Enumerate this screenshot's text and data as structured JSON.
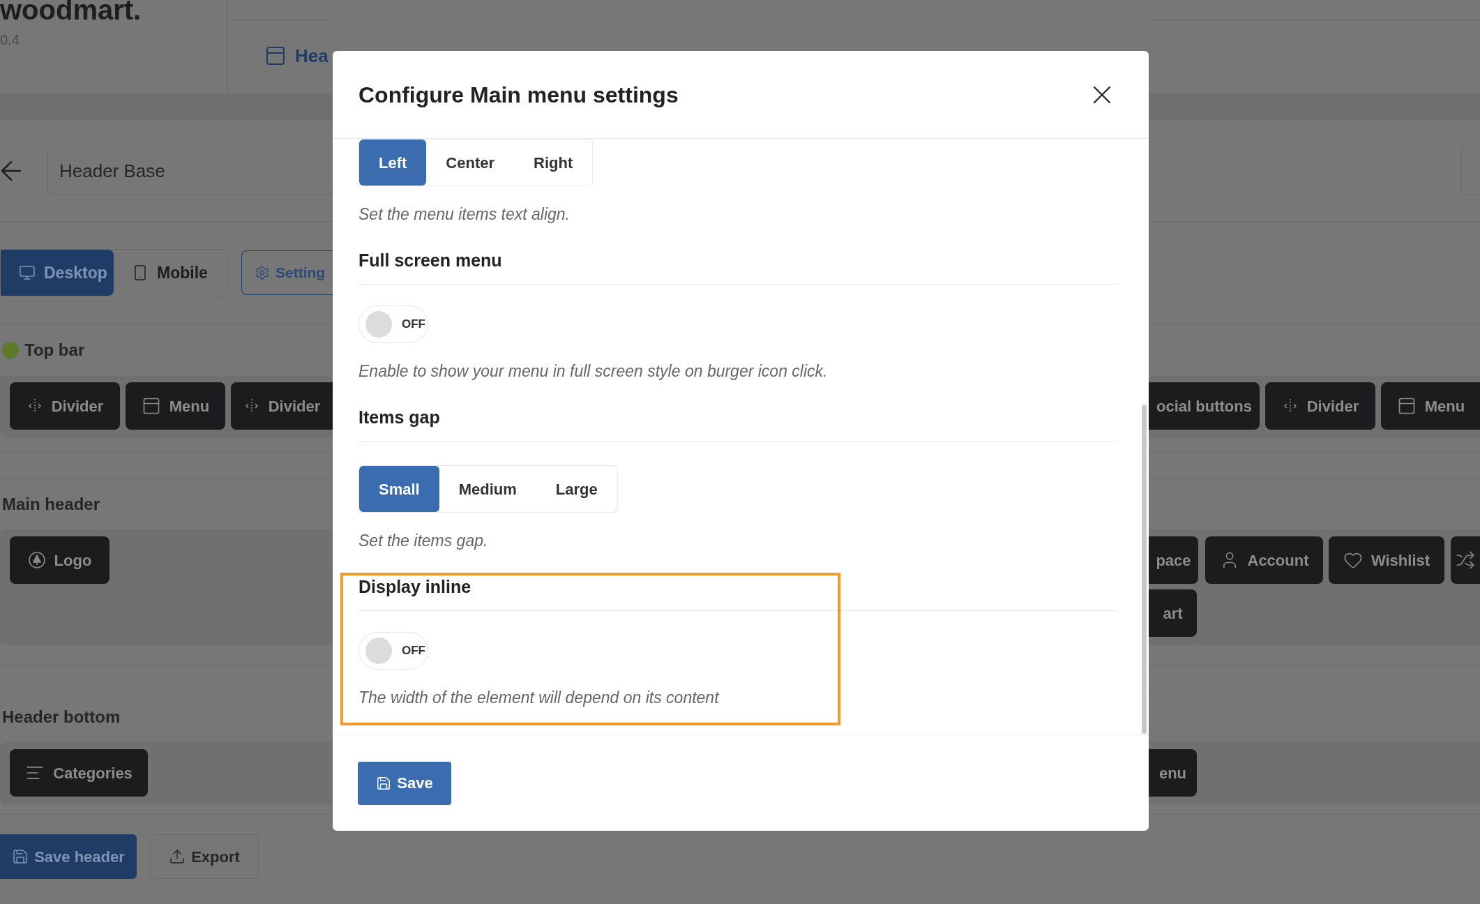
{
  "background": {
    "logo": "woodmart.",
    "version": "0.4",
    "nav_tab": "Hea",
    "back_label": "Header Base",
    "view_tabs": [
      {
        "label": "Desktop",
        "selected": true
      },
      {
        "label": "Mobile",
        "selected": false
      }
    ],
    "settings_button": "Setting",
    "rows": [
      {
        "title": "Top bar",
        "color": "#5d7a2b",
        "left": [
          {
            "kind": "divider",
            "label": "Divider"
          },
          {
            "kind": "menu",
            "label": "Menu"
          },
          {
            "kind": "divider",
            "label": "Divider"
          }
        ],
        "right": [
          [
            {
              "kind": "text",
              "label": "ocial buttons"
            },
            {
              "kind": "divider",
              "label": "Divider"
            },
            {
              "kind": "menu",
              "label": "Menu"
            }
          ]
        ]
      },
      {
        "title": "Main header",
        "left": [
          {
            "kind": "logo",
            "label": "Logo"
          }
        ],
        "right": [
          [
            {
              "kind": "text",
              "label": "pace"
            },
            {
              "kind": "account",
              "label": "Account"
            },
            {
              "kind": "wishlist",
              "label": "Wishlist"
            },
            {
              "kind": "compare"
            }
          ],
          [
            {
              "kind": "text",
              "label": "art"
            }
          ]
        ]
      },
      {
        "title": "Header bottom",
        "left": [
          {
            "kind": "categories",
            "label": "Categories"
          }
        ],
        "right": [
          [
            {
              "kind": "text",
              "label": "enu"
            }
          ]
        ]
      }
    ],
    "save_header": "Save header",
    "export": "Export"
  },
  "dialog": {
    "title": "Configure Main menu settings",
    "settings": [
      {
        "kind": "options",
        "options": [
          {
            "label": "Left",
            "selected": true
          },
          {
            "label": "Center",
            "selected": false
          },
          {
            "label": "Right",
            "selected": false
          }
        ],
        "description": "Set the menu items text align."
      },
      {
        "kind": "switch",
        "title": "Full screen menu",
        "on": false,
        "state_label": "OFF",
        "description": "Enable to show your menu in full screen style on burger icon click."
      },
      {
        "kind": "options",
        "title": "Items gap",
        "options": [
          {
            "label": "Small",
            "selected": true
          },
          {
            "label": "Medium",
            "selected": false
          },
          {
            "label": "Large",
            "selected": false
          }
        ],
        "description": "Set the items gap."
      },
      {
        "kind": "switch",
        "title": "Display inline",
        "on": false,
        "state_label": "OFF",
        "description": "The width of the element will depend on its content",
        "highlighted": true
      }
    ],
    "save": "Save"
  }
}
